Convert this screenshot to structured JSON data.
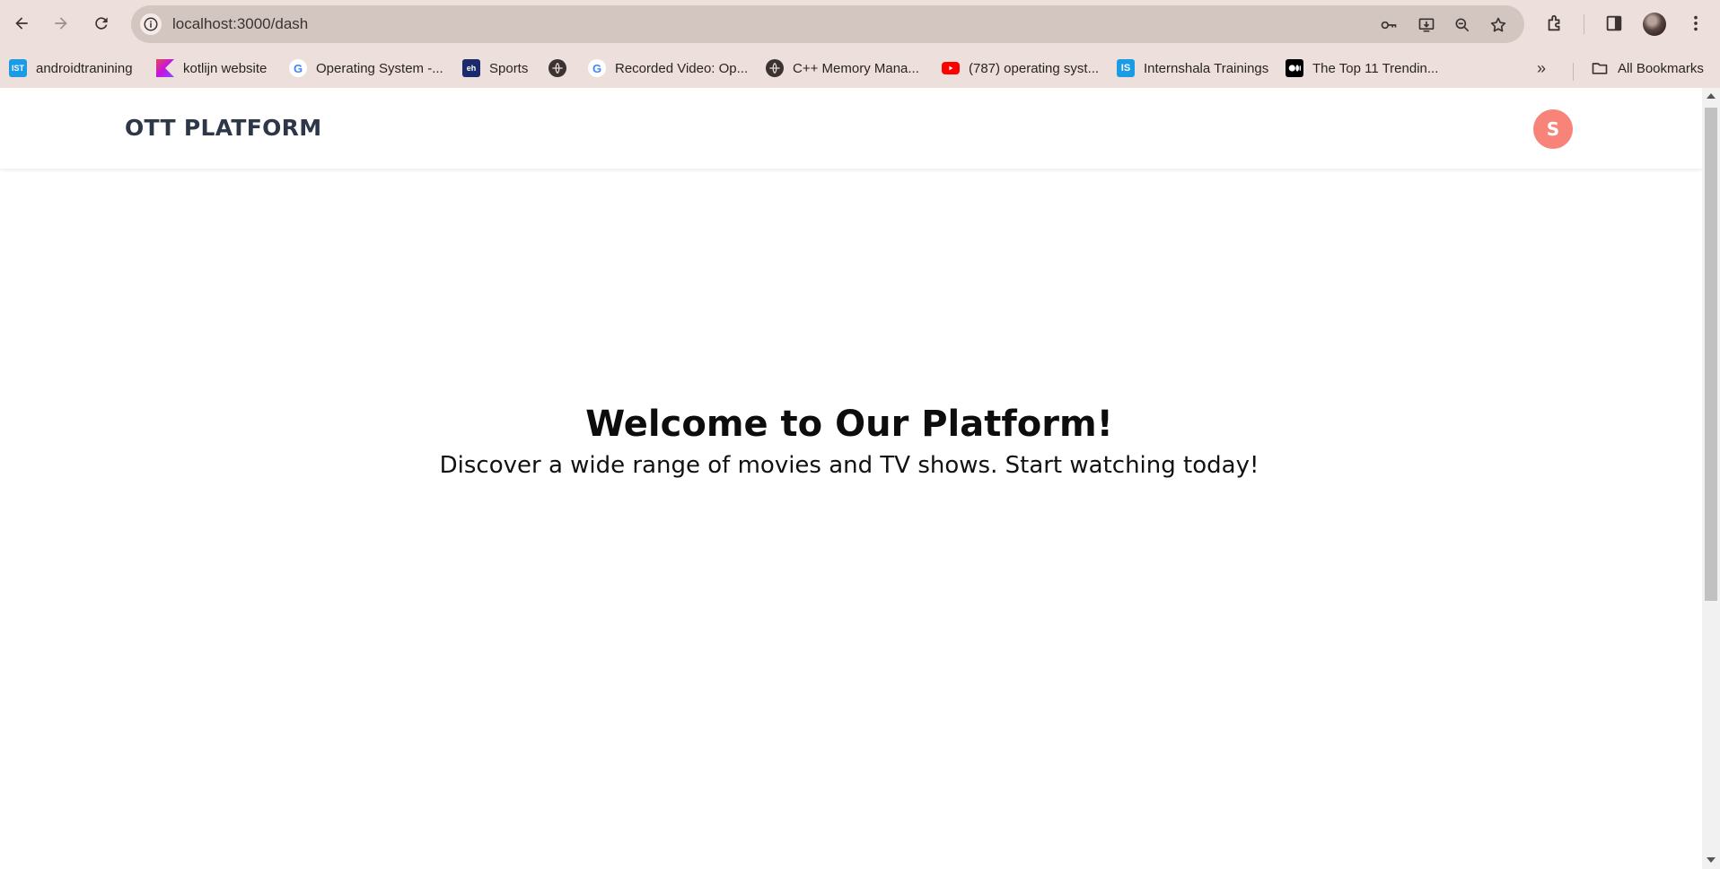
{
  "browser": {
    "url": "localhost:3000/dash",
    "bookmarks": [
      {
        "label": "androidtranining",
        "favicon": "IST",
        "color": "#1a9be6"
      },
      {
        "label": "kotlijn website",
        "favicon": "K",
        "color": "#8a4dfb"
      },
      {
        "label": "Operating System -...",
        "favicon": "G",
        "color": "#ffffff"
      },
      {
        "label": "Sports",
        "favicon": "eh",
        "color": "#1b2a6b"
      },
      {
        "label": "",
        "favicon": "globe",
        "color": "#3b3331"
      },
      {
        "label": "Recorded Video: Op...",
        "favicon": "G",
        "color": "#ffffff"
      },
      {
        "label": "C++ Memory Mana...",
        "favicon": "globe",
        "color": "#3b3331"
      },
      {
        "label": "(787) operating syst...",
        "favicon": "youtube",
        "color": "#ff0000"
      },
      {
        "label": "Internshala Trainings",
        "favicon": "IS",
        "color": "#1a9be6"
      },
      {
        "label": "The Top 11 Trendin...",
        "favicon": "medium",
        "color": "#000000"
      }
    ],
    "more_label": "»",
    "all_bookmarks": "All Bookmarks"
  },
  "header": {
    "brand": "OTT PLATFORM",
    "avatar_initial": "S",
    "avatar_color": "#f88379"
  },
  "hero": {
    "title": "Welcome to Our Platform!",
    "subtitle": "Discover a wide range of movies and TV shows. Start watching today!"
  }
}
